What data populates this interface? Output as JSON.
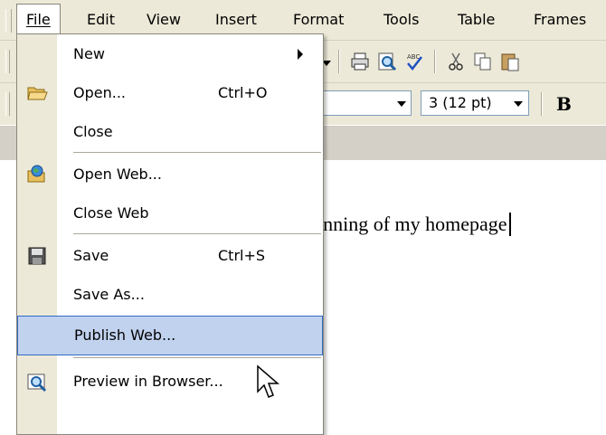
{
  "menubar": {
    "items": [
      {
        "label": "File"
      },
      {
        "label": "Edit"
      },
      {
        "label": "View"
      },
      {
        "label": "Insert"
      },
      {
        "label": "Format"
      },
      {
        "label": "Tools"
      },
      {
        "label": "Table"
      },
      {
        "label": "Frames"
      }
    ]
  },
  "toolbar": {
    "font_size_value": "3 (12 pt)",
    "bold_label": "B"
  },
  "document": {
    "text": "ginning of my homepage"
  },
  "file_menu": {
    "items": [
      {
        "label": "New",
        "shortcut": ""
      },
      {
        "label": "Open...",
        "shortcut": "Ctrl+O"
      },
      {
        "label": "Close",
        "shortcut": ""
      },
      {
        "label": "Open Web...",
        "shortcut": ""
      },
      {
        "label": "Close Web",
        "shortcut": ""
      },
      {
        "label": "Save",
        "shortcut": "Ctrl+S"
      },
      {
        "label": "Save As...",
        "shortcut": ""
      },
      {
        "label": "Publish Web...",
        "shortcut": ""
      },
      {
        "label": "Preview in Browser...",
        "shortcut": ""
      }
    ],
    "highlighted": "Publish Web..."
  },
  "colors": {
    "menu_highlight": "#c1d2ee",
    "menu_highlight_border": "#316ac5",
    "chrome": "#ece9d8"
  }
}
